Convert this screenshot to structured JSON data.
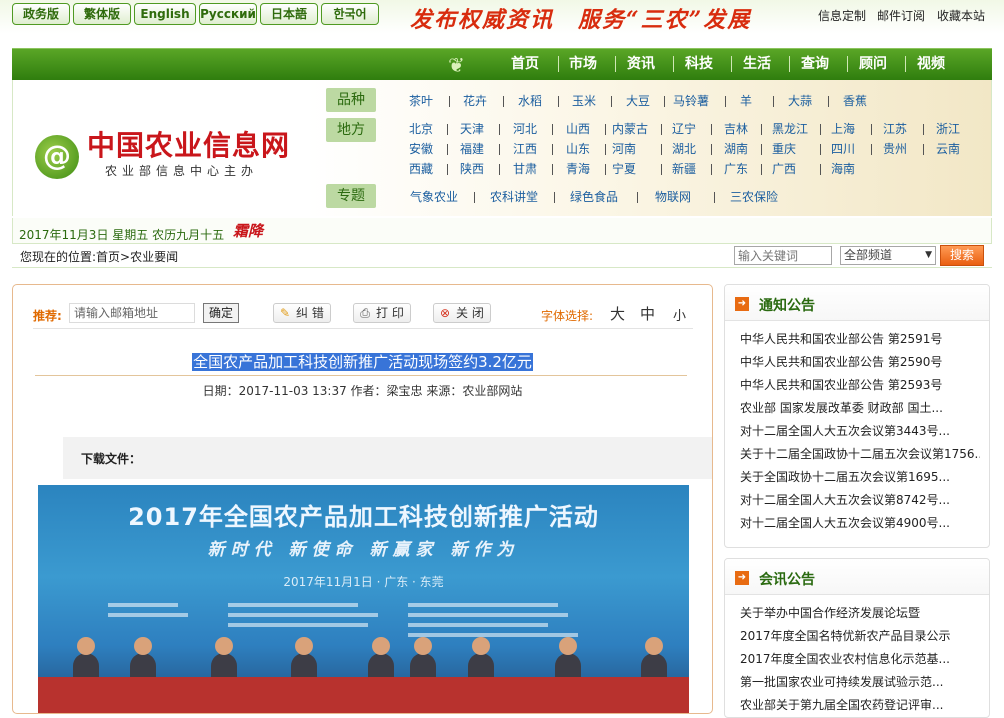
{
  "top": {
    "langs": [
      "政务版",
      "繁体版",
      "English",
      "Русский",
      "日本語",
      "한국어"
    ],
    "slogan": "发布权威资讯　服务“三农”发展",
    "links": [
      "信息定制",
      "邮件订阅",
      "收藏本站"
    ]
  },
  "nav": [
    "首页",
    "市场",
    "资讯",
    "科技",
    "生活",
    "查询",
    "顾问",
    "视频"
  ],
  "logo": {
    "icon": "@",
    "title": "中国农业信息网",
    "subtitle": "农业部信息中心主办"
  },
  "categories": {
    "product_label": "品种",
    "products": [
      "茶叶",
      "花卉",
      "水稻",
      "玉米",
      "大豆",
      "马铃薯",
      "羊",
      "大蒜",
      "香蕉"
    ],
    "region_label": "地方",
    "regions_row1": [
      "北京",
      "天津",
      "河北",
      "山西",
      "内蒙古",
      "辽宁",
      "吉林",
      "黑龙江",
      "上海",
      "江苏",
      "浙江"
    ],
    "regions_row2": [
      "安徽",
      "福建",
      "江西",
      "山东",
      "河南",
      "湖北",
      "湖南",
      "重庆",
      "四川",
      "贵州",
      "云南"
    ],
    "regions_row3": [
      "西藏",
      "陕西",
      "甘肃",
      "青海",
      "宁夏",
      "新疆",
      "广东",
      "广西",
      "海南"
    ],
    "topic_label": "专题",
    "topics": [
      "气象农业",
      "农科讲堂",
      "绿色食品",
      "物联网",
      "三农保险"
    ]
  },
  "datebar": {
    "date": "2017年11月3日  星期五  农历九月十五",
    "solar_term": "霜降"
  },
  "location": {
    "text": "您现在的位置:首页>农业要闻",
    "search_placeholder": "输入关键词",
    "channel": "全部频道",
    "search_button": "搜索"
  },
  "article": {
    "push_label": "推荐:",
    "push_placeholder": "请输入邮箱地址",
    "push_ok": "确定",
    "correct": "纠 错",
    "print": "打 印",
    "close": "关 闭",
    "font_label": "字体选择:",
    "font_large": "大",
    "font_medium": "中",
    "font_small": "小",
    "title": "全国农产品加工科技创新推广活动现场签约3.2亿元",
    "meta": "日期：2017-11-03 13:37 作者：梁宝忠 来源：农业部网站",
    "download_label": "下载文件：",
    "photo": {
      "title": "2017年全国农产品加工科技创新推广活动",
      "motto": "新时代 新使命 新赢家 新作为",
      "date": "2017年11月1日 · 广东 · 东莞"
    }
  },
  "notice": {
    "title": "通知公告",
    "items": [
      "中华人民共和国农业部公告 第2591号",
      "中华人民共和国农业部公告 第2590号",
      "中华人民共和国农业部公告 第2593号",
      "农业部 国家发展改革委 财政部 国土...",
      "对十二届全国人大五次会议第3443号...",
      "关于十二届全国政协十二届五次会议第1756...",
      "关于全国政协十二届五次会议第1695...",
      "对十二届全国人大五次会议第8742号...",
      "对十二届全国人大五次会议第4900号..."
    ]
  },
  "meeting": {
    "title": "会讯公告",
    "items": [
      "关于举办中国合作经济发展论坛暨",
      "2017年度全国名特优新农产品目录公示",
      "2017年度全国农业农村信息化示范基...",
      "第一批国家农业可持续发展试验示范...",
      "农业部关于第九届全国农药登记评审..."
    ]
  },
  "colors": {
    "nav_green": "#3f8f16",
    "brand_red": "#c9161b",
    "link_blue": "#1b5e9f",
    "accent_orange": "#e86b12"
  }
}
